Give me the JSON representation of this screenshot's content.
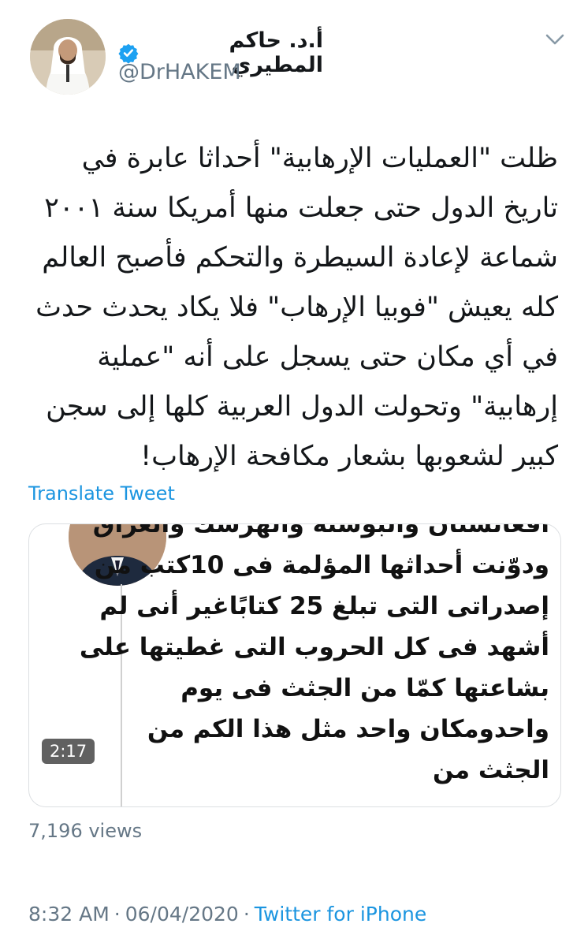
{
  "author": {
    "display_name": "أ.د. حاكم المطيري",
    "handle": "@DrHAKEM",
    "verified": true,
    "verified_icon": "verified-badge-icon",
    "verified_color": "#1da1f2"
  },
  "tweet": {
    "text": "ظلت \"العمليات الإرهابية\" أحداثا عابرة في تاريخ الدول حتى جعلت منها أمريكا سنة ٢٠٠١ شماعة لإعادة السيطرة والتحكم فأصبح العالم كله يعيش \"فوبيا الإرهاب\" فلا يكاد يحدث حدث في أي مكان حتى يسجل على أنه \"عملية إرهابية\" وتحولت الدول العربية كلها إلى سجن كبير لشعوبها بشعار مكافحة الإرهاب!",
    "translate_label": "Translate Tweet"
  },
  "media": {
    "duration": "2:17",
    "caption_text": "أفغانستان والبوسنة والهرسك والعراق ودوّنت أحداثها المؤلمة فى 10كتب من إصدراتى التى تبلغ 25 كتابًاغير أنى لم أشهد فى كل الحروب التى غطيتها على بشاعتها كمّا من الجثث فى يوم واحدومكان واحد مثل هذا الكم من الجثث من"
  },
  "stats": {
    "views": "7,196 views"
  },
  "footer": {
    "time": "8:32 AM",
    "date": "06/04/2020",
    "separator": "·",
    "source": "Twitter for iPhone"
  },
  "colors": {
    "link": "#1b95e0",
    "muted": "#657786",
    "text": "#14171a"
  }
}
